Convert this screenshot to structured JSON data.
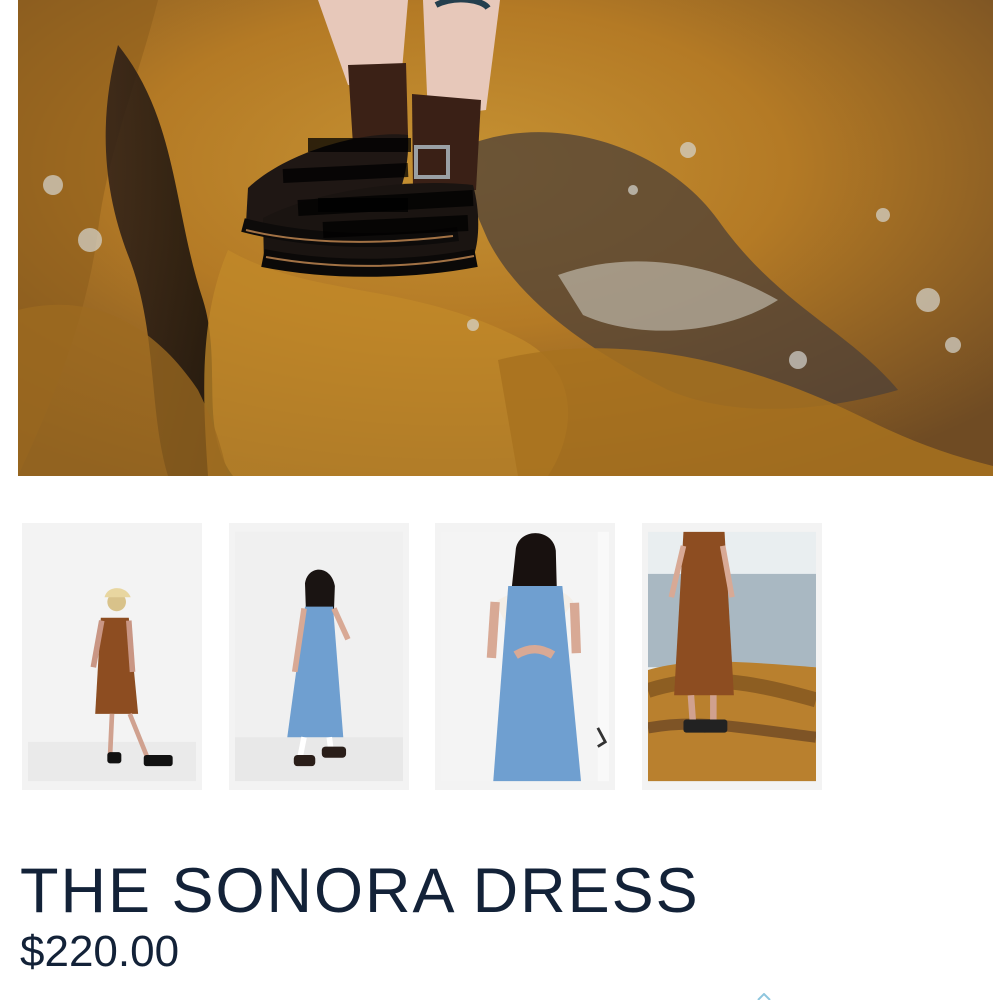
{
  "product": {
    "title": "THE SONORA DRESS",
    "price": "$220.00"
  },
  "gallery": {
    "thumbnails": [
      {
        "name": "brown-dress-studio"
      },
      {
        "name": "blue-dress-studio"
      },
      {
        "name": "blue-dress-scarf"
      },
      {
        "name": "brown-dress-rocks"
      }
    ]
  },
  "colors": {
    "text": "#132238",
    "rock": "#b77f26",
    "brown_dress": "#8b4b22",
    "blue_dress": "#6f9fd0"
  }
}
